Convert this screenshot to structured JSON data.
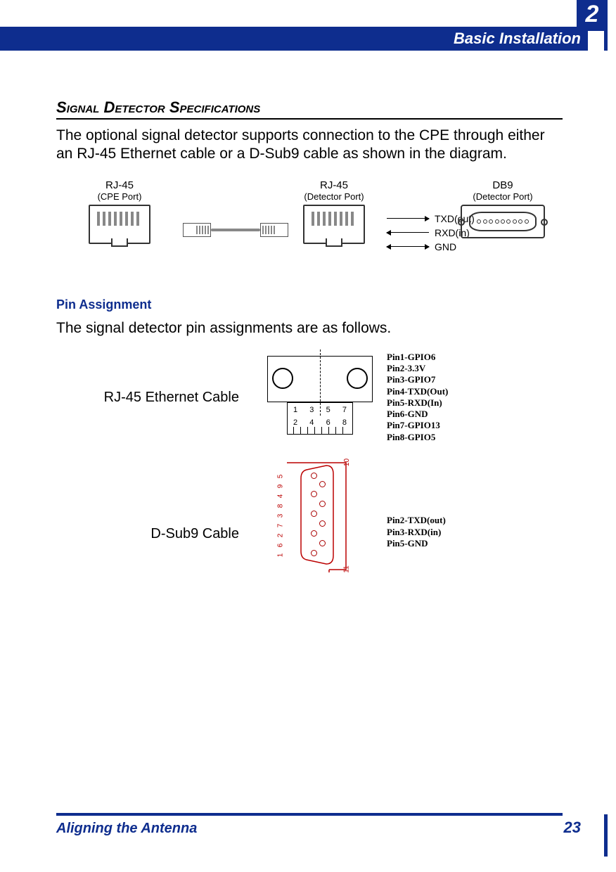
{
  "header": {
    "chapter_label": "Basic Installation",
    "chapter_number": "2"
  },
  "section": {
    "title": "Signal Detector Specifications",
    "body": "The optional signal detector supports connection to the CPE through either an RJ-45 Ethernet cable or a D-Sub9 cable as shown in the diagram."
  },
  "diagram1": {
    "ports": {
      "rj45_cpe": {
        "title": "RJ-45",
        "sub": "(CPE Port)"
      },
      "rj45_det": {
        "title": "RJ-45",
        "sub": "(Detector Port)"
      },
      "db9_det": {
        "title": "DB9",
        "sub": "(Detector Port)"
      }
    },
    "signals": [
      "TXD(out)",
      "RXD(in)",
      "GND"
    ]
  },
  "subsection": {
    "title": "Pin Assignment",
    "body": "The signal detector pin assignments are as follows."
  },
  "pin_assignment": {
    "rj45_label": "RJ-45 Ethernet Cable",
    "rj45_pins": [
      "Pin1-GPIO6",
      "Pin2-3.3V",
      "Pin3-GPIO7",
      "Pin4-TXD(Out)",
      "Pin5-RXD(In)",
      "Pin6-GND",
      "Pin7-GPIO13",
      "Pin8-GPIO5"
    ],
    "rj45_row1": [
      "1",
      "3",
      "5",
      "7"
    ],
    "rj45_row2": [
      "2",
      "4",
      "6",
      "8"
    ],
    "dsub_label": "D-Sub9 Cable",
    "dsub_pins": [
      "Pin2-TXD(out)",
      "Pin3-RXD(in)",
      "Pin5-GND"
    ],
    "dsub_numbers_left": [
      "5",
      "9",
      "4",
      "8",
      "3",
      "7",
      "2",
      "6",
      "1"
    ],
    "dsub_frame_top": "10",
    "dsub_frame_bottom": "11"
  },
  "footer": {
    "left": "Aligning the Antenna",
    "page": "23"
  }
}
